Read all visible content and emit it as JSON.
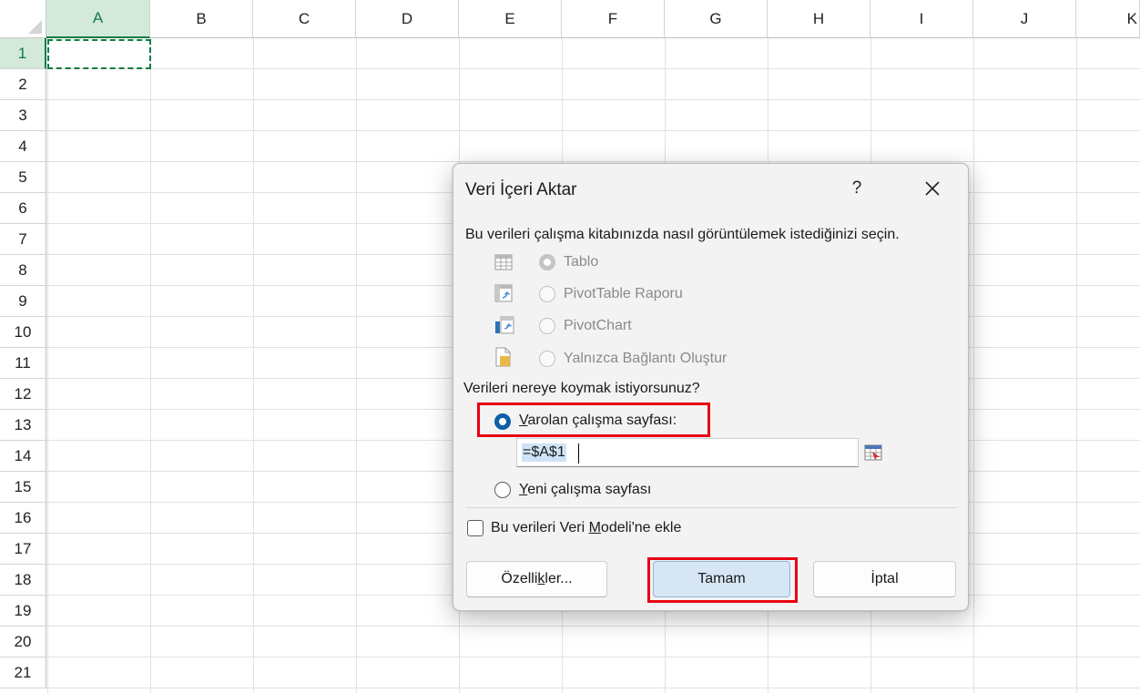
{
  "sheet": {
    "columns": [
      "A",
      "B",
      "C",
      "D",
      "E",
      "F",
      "G",
      "H",
      "I",
      "J",
      "K"
    ],
    "rows": [
      "1",
      "2",
      "3",
      "4",
      "5",
      "6",
      "7",
      "8",
      "9",
      "10",
      "11",
      "12",
      "13",
      "14",
      "15",
      "16",
      "17",
      "18",
      "19",
      "20",
      "21"
    ],
    "selected_cell": "A1"
  },
  "dialog": {
    "title": "Veri İçeri Aktar",
    "help_label": "?",
    "view_prompt": "Bu verileri çalışma kitabınızda nasıl görüntülemek istediğinizi seçin.",
    "view_options": [
      {
        "label": "Tablo",
        "icon": "table-icon",
        "checked": true
      },
      {
        "label": "PivotTable Raporu",
        "icon": "pivottable-icon",
        "checked": false
      },
      {
        "label": "PivotChart",
        "icon": "pivotchart-icon",
        "checked": false
      },
      {
        "label": "Yalnızca Bağlantı Oluştur",
        "icon": "connection-icon",
        "checked": false
      }
    ],
    "location_prompt": "Verileri nereye koymak istiyorsunuz?",
    "existing_sheet": {
      "access_key": "V",
      "rest": "arolan çalışma sayfası:",
      "checked": true
    },
    "reference_value": "=$A$1",
    "new_sheet": {
      "access_key": "Y",
      "rest": "eni çalışma sayfası",
      "checked": false
    },
    "data_model": {
      "before": "Bu verileri Veri ",
      "access_key": "M",
      "after": "odeli'ne ekle",
      "checked": false
    },
    "buttons": {
      "properties": {
        "before": "Özelli",
        "access_key": "k",
        "after": "ler..."
      },
      "ok": "Tamam",
      "cancel": "İptal"
    }
  },
  "colors": {
    "accent_green": "#107c41",
    "radio_blue": "#0f5ea8",
    "highlight_red": "#e60012"
  }
}
